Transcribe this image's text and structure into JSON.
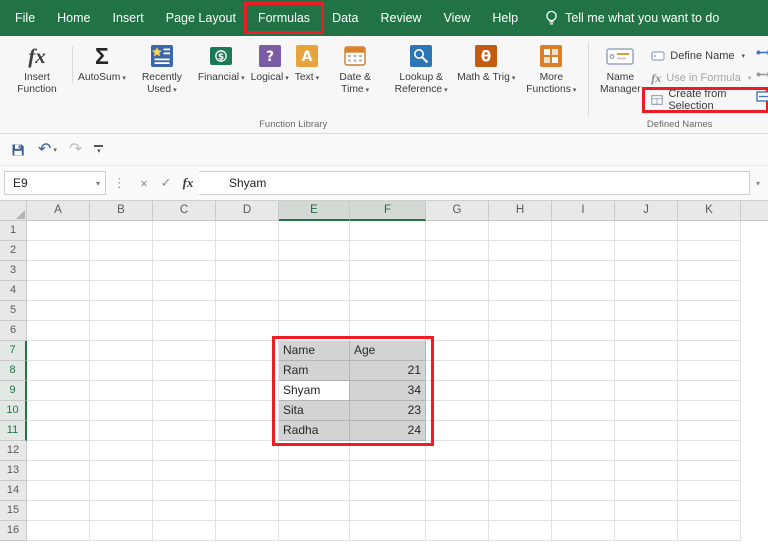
{
  "tab_bar": {
    "tabs": [
      {
        "label": "File"
      },
      {
        "label": "Home"
      },
      {
        "label": "Insert"
      },
      {
        "label": "Page Layout"
      },
      {
        "label": "Formulas",
        "annotated": true
      },
      {
        "label": "Data"
      },
      {
        "label": "Review"
      },
      {
        "label": "View"
      },
      {
        "label": "Help"
      }
    ],
    "tell_me": "Tell me what you want to do"
  },
  "ribbon": {
    "function_library": {
      "group_label": "Function Library",
      "insert_function_label": "Insert Function",
      "buttons": [
        {
          "label": "AutoSum"
        },
        {
          "label": "Recently Used"
        },
        {
          "label": "Financial"
        },
        {
          "label": "Logical"
        },
        {
          "label": "Text"
        },
        {
          "label": "Date & Time"
        },
        {
          "label": "Lookup & Reference"
        },
        {
          "label": "Math & Trig"
        },
        {
          "label": "More Functions"
        }
      ]
    },
    "defined_names": {
      "group_label": "Defined Names",
      "name_manager_label": "Name Manager",
      "items": [
        {
          "label": "Define Name",
          "enabled": true
        },
        {
          "label": "Use in Formula",
          "enabled": false
        },
        {
          "label": "Create from Selection",
          "enabled": true,
          "annotated": true
        }
      ]
    }
  },
  "formula_bar": {
    "name_box": "E9",
    "value": "Shyam"
  },
  "icons": {
    "fx_glyph": "fx",
    "autosum_glyph": "Σ",
    "logical_glyph": "?",
    "text_glyph": "A",
    "math_glyph": "θ",
    "financial_glyph": "$"
  },
  "grid": {
    "columns": [
      "A",
      "B",
      "C",
      "D",
      "E",
      "F",
      "G",
      "H",
      "I",
      "J",
      "K"
    ],
    "row_count": 16,
    "selected_columns": [
      "E",
      "F"
    ],
    "selected_rows": [
      7,
      8,
      9,
      10,
      11
    ],
    "active_cell": "E9"
  },
  "sheet_table": {
    "origin_col": "E",
    "origin_row": 7,
    "rows": [
      [
        "Name",
        "Age"
      ],
      [
        "Ram",
        "21"
      ],
      [
        "Shyam",
        "34"
      ],
      [
        "Sita",
        "23"
      ],
      [
        "Radha",
        "24"
      ]
    ]
  },
  "annotations": {
    "color": "#ee1c25",
    "boxes": [
      "formulas-tab",
      "create-from-selection-button",
      "data-table-e7-f11"
    ]
  },
  "colors": {
    "excel_green": "#217346",
    "selection_fill": "#d3d3d3",
    "annotation_red": "#ee1c25"
  }
}
